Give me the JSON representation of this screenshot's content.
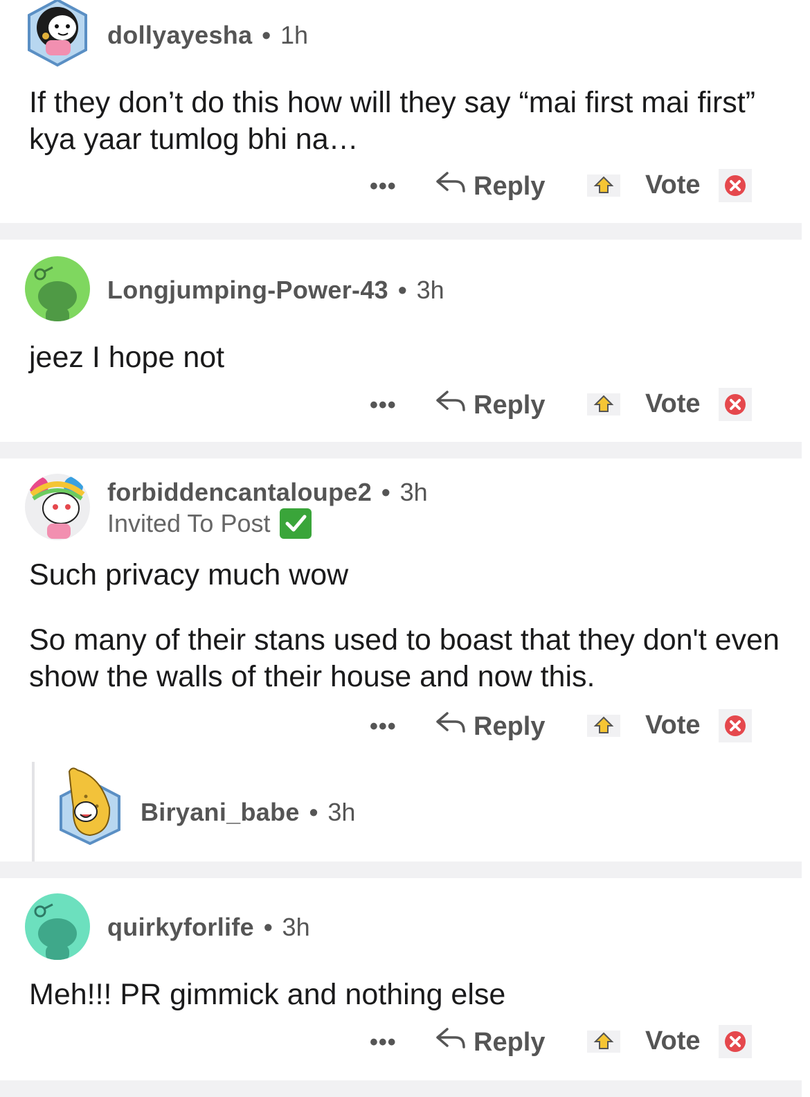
{
  "colors": {
    "divider": "#f1f1f3",
    "meta_text": "#555555",
    "check_green": "#3aa53a",
    "close_red": "#e5484d"
  },
  "actions": {
    "more": "•••",
    "reply": "Reply",
    "vote": "Vote"
  },
  "comments": [
    {
      "username": "dollyayesha",
      "time": "1h",
      "avatar": "snoo-avatar-dark-hair",
      "body": [
        "If they don’t do this how will they say “mai first mai first” kya yaar tumlog bhi na…"
      ]
    },
    {
      "username": "Longjumping-Power-43",
      "time": "3h",
      "avatar": "default-snoo-green",
      "body": [
        "jeez I hope not"
      ]
    },
    {
      "username": "forbiddencantaloupe2",
      "time": "3h",
      "flair": "Invited To Post",
      "avatar": "snoo-avatar-rainbow-hair",
      "body": [
        "Such privacy much wow",
        "So many of their stans used to boast  that they don't even show the walls of their house and now this."
      ]
    },
    {
      "username": "Biryani_babe",
      "time": "3h",
      "avatar": "snoo-avatar-banana"
    },
    {
      "username": "quirkyforlife",
      "time": "3h",
      "avatar": "default-snoo-teal",
      "body": [
        "Meh!!! PR gimmick and nothing else"
      ]
    }
  ]
}
